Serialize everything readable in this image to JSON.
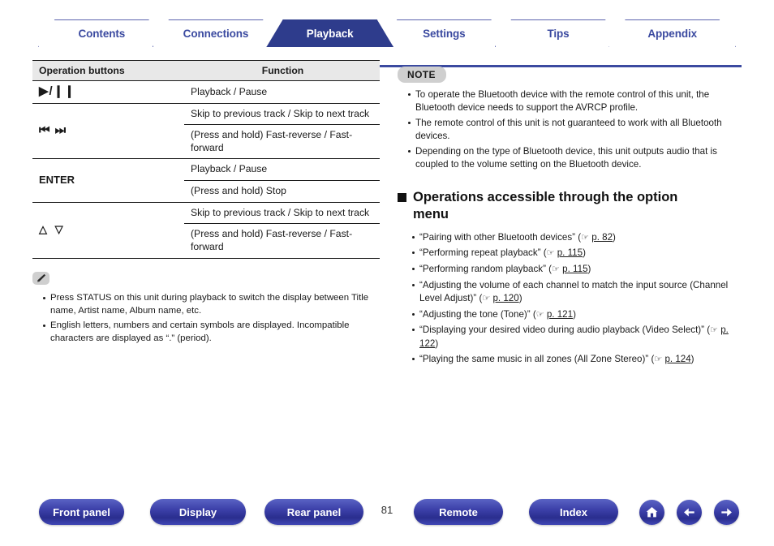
{
  "tabs": [
    {
      "label": "Contents",
      "active": false
    },
    {
      "label": "Connections",
      "active": false
    },
    {
      "label": "Playback",
      "active": true
    },
    {
      "label": "Settings",
      "active": false
    },
    {
      "label": "Tips",
      "active": false
    },
    {
      "label": "Appendix",
      "active": false
    }
  ],
  "table": {
    "headers": {
      "buttons": "Operation buttons",
      "function": "Function"
    },
    "rows": [
      {
        "button": "▶/❙❙",
        "button_kind": "symbol",
        "functions": [
          "Playback / Pause"
        ]
      },
      {
        "button": "⏮  ⏭",
        "button_kind": "symbol",
        "functions": [
          "Skip to previous track / Skip to next track",
          "(Press and hold) Fast-reverse / Fast-forward"
        ]
      },
      {
        "button": "ENTER",
        "button_kind": "text",
        "functions": [
          "Playback / Pause",
          "(Press and hold) Stop"
        ]
      },
      {
        "button": "△ ▽",
        "button_kind": "symbol",
        "functions": [
          "Skip to previous track / Skip to next track",
          "(Press and hold) Fast-reverse / Fast-forward"
        ]
      }
    ]
  },
  "pencil_note": {
    "badge": "pencil-icon",
    "items": [
      "Press STATUS on this unit during playback to switch the display between Title name, Artist name, Album name, etc.",
      "English letters, numbers and certain symbols are displayed. Incompatible characters are displayed as “.” (period)."
    ]
  },
  "note": {
    "badge": "NOTE",
    "items": [
      "To operate the Bluetooth device with the remote control of this unit, the Bluetooth device needs to support the AVRCP profile.",
      "The remote control of this unit is not guaranteed to work with all Bluetooth devices.",
      "Depending on the type of Bluetooth device, this unit outputs audio that is coupled to the volume setting on the Bluetooth device."
    ]
  },
  "option_menu": {
    "heading": "Operations accessible through the option menu",
    "links": [
      {
        "text": "“Pairing with other Bluetooth devices”",
        "page": "p. 82"
      },
      {
        "text": "“Performing repeat playback”",
        "page": "p. 115"
      },
      {
        "text": "“Performing random playback”",
        "page": "p. 115"
      },
      {
        "text": "“Adjusting the volume of each channel to match the input source (Channel Level Adjust)”",
        "page": "p. 120"
      },
      {
        "text": "“Adjusting the tone (Tone)”",
        "page": "p. 121"
      },
      {
        "text": "“Displaying your desired video during audio playback (Video Select)”",
        "page": "p. 122"
      },
      {
        "text": "“Playing the same music in all zones (All Zone Stereo)”",
        "page": "p. 124"
      }
    ]
  },
  "footer": {
    "buttons": [
      "Front panel",
      "Display",
      "Rear panel",
      "Remote",
      "Index"
    ],
    "page_number": "81",
    "icons": [
      "home-icon",
      "back-arrow-icon",
      "forward-arrow-icon"
    ]
  },
  "colors": {
    "brand_blue": "#2e3c8c",
    "tab_text": "#3b4aa0",
    "badge_gray": "#cfcfcf",
    "table_header_gray": "#e8e8e8"
  }
}
